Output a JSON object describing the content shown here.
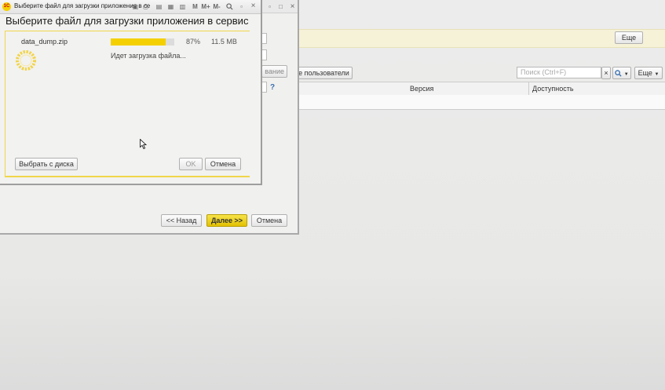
{
  "background": {
    "more_top": "Еще",
    "users_btn": "е пользователи",
    "search_placeholder": "Поиск (Ctrl+F)",
    "clear_icon": "×",
    "more_right": "Еще",
    "col_version": "Версия",
    "col_availability": "Доступность",
    "help": "?"
  },
  "wizard": {
    "partial_button": "вание",
    "back": "<< Назад",
    "next": "Далее >>",
    "cancel": "Отмена"
  },
  "dialog": {
    "window_title": "Выберите файл для загрузки приложения в се",
    "logo": "1С",
    "toolbar": {
      "m": "M",
      "mplus": "M+",
      "mminus": "M-"
    },
    "title": "Выберите файл для загрузки приложения в сервис",
    "file_name": "data_dump.zip",
    "progress": 0.87,
    "percent": "87%",
    "size": "11.5 MB",
    "status": "Идет загрузка файла...",
    "select_from_disk": "Выбрать с диска",
    "ok": "OK",
    "cancel": "Отмена"
  },
  "colors": {
    "accent": "#f5d000",
    "panel_bg": "#f2f2f0",
    "yellow_band": "#f5f2d8"
  }
}
